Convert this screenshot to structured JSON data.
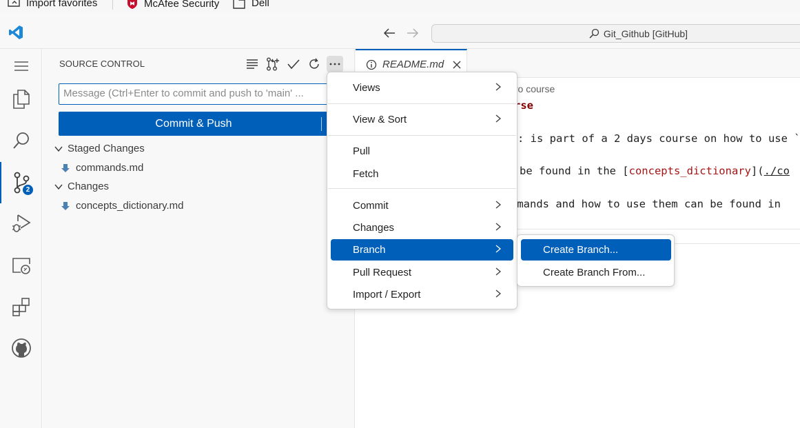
{
  "favorites": {
    "import_label": "Import favorites",
    "mcafee_label": "McAfee Security",
    "dell_label": "Dell"
  },
  "titlebar": {
    "command_center": "Git_Github [GitHub]"
  },
  "activity": {
    "scm_badge": "2"
  },
  "scm": {
    "title": "SOURCE CONTROL",
    "message_placeholder": "Message (Ctrl+Enter to commit and push to 'main' ...",
    "commit_label": "Commit & Push",
    "staged_label": "Staged Changes",
    "staged_files": [
      "commands.md"
    ],
    "changes_label": "Changes",
    "changed_files": [
      "concepts_dictionary.md"
    ]
  },
  "editor": {
    "tab_label": "README.md",
    "breadcrumb_fragment": "tro course",
    "heading_fragment": "rse",
    "line1": ": is part of a 2 days course on how to use `",
    "line2_pre": "be found in the [",
    "line2_link": "concepts_dictionary",
    "line2_mid": "](",
    "line2_url": "./co",
    "line3": "nmands and how to use them can be found in"
  },
  "context_menu": {
    "views": "Views",
    "view_sort": "View & Sort",
    "pull": "Pull",
    "fetch": "Fetch",
    "commit": "Commit",
    "changes": "Changes",
    "branch": "Branch",
    "pull_request": "Pull Request",
    "import_export": "Import / Export"
  },
  "submenu": {
    "create_branch": "Create Branch...",
    "create_branch_from": "Create Branch From..."
  },
  "colors": {
    "accent": "#005fb8",
    "markdown_heading": "#800000",
    "markdown_link": "#a31515"
  }
}
